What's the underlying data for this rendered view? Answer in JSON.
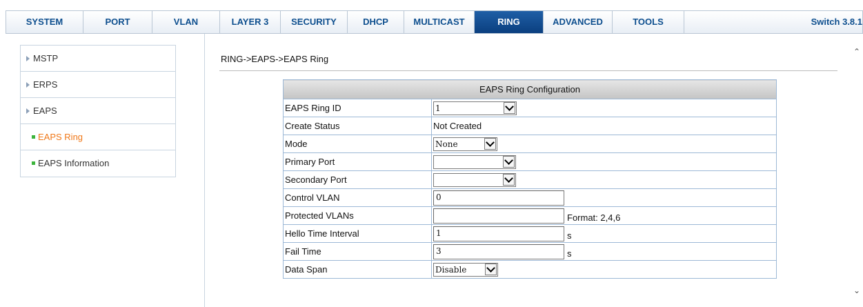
{
  "nav": {
    "tabs": [
      {
        "label": "SYSTEM",
        "width": 112
      },
      {
        "label": "PORT",
        "width": 100
      },
      {
        "label": "VLAN",
        "width": 98
      },
      {
        "label": "LAYER 3",
        "width": 88
      },
      {
        "label": "SECURITY",
        "width": 97
      },
      {
        "label": "DHCP",
        "width": 82
      },
      {
        "label": "MULTICAST",
        "width": 102
      },
      {
        "label": "RING",
        "width": 100
      },
      {
        "label": "ADVANCED",
        "width": 100
      },
      {
        "label": "TOOLS",
        "width": 104
      }
    ],
    "active_tab": "RING",
    "version": "Switch 3.8.1"
  },
  "sidebar": {
    "items": [
      {
        "label": "MSTP"
      },
      {
        "label": "ERPS"
      },
      {
        "label": "EAPS"
      }
    ],
    "subitems": [
      {
        "label": "EAPS Ring",
        "current": true
      },
      {
        "label": "EAPS Information",
        "current": false
      }
    ]
  },
  "breadcrumb": "RING->EAPS->EAPS Ring",
  "form": {
    "title": "EAPS Ring Configuration",
    "ring_id": {
      "label": "EAPS Ring ID",
      "value": "1"
    },
    "create_status": {
      "label": "Create Status",
      "value": "Not Created"
    },
    "mode": {
      "label": "Mode",
      "value": "None"
    },
    "primary_port": {
      "label": "Primary Port",
      "value": ""
    },
    "secondary_port": {
      "label": "Secondary Port",
      "value": ""
    },
    "control_vlan": {
      "label": "Control VLAN",
      "value": "0"
    },
    "protected_vlans": {
      "label": "Protected VLANs",
      "value": "",
      "hint": "Format: 2,4,6"
    },
    "hello_time": {
      "label": "Hello Time Interval",
      "value": "1",
      "unit": "s"
    },
    "fail_time": {
      "label": "Fail Time",
      "value": "3",
      "unit": "s"
    },
    "data_span": {
      "label": "Data Span",
      "value": "Disable"
    }
  },
  "colors": {
    "nav_text": "#0d4e8e",
    "active_tab_bg": "#0a3f7f",
    "current_item": "#f07818",
    "bullet": "#3cb43c"
  }
}
